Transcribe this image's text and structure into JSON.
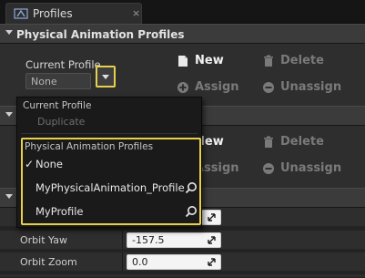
{
  "tab": {
    "label": "Profiles",
    "close": "×"
  },
  "sections": {
    "physical": {
      "title": "Physical Animation Profiles"
    }
  },
  "profile": {
    "current_label": "Current Profile",
    "current_value": "None"
  },
  "actions": {
    "new": "New",
    "delete": "Delete",
    "assign": "Assign",
    "unassign": "Unassign"
  },
  "properties": [
    {
      "name": "Orbit Yaw",
      "value": "-157.5"
    },
    {
      "name": "Orbit Zoom",
      "value": "0.0"
    }
  ],
  "popup": {
    "current_title": "Current Profile",
    "duplicate": "Duplicate",
    "list_title": "Physical Animation Profiles",
    "items": [
      {
        "label": "None",
        "checked": "✓"
      },
      {
        "label": "MyPhysicalAnimation_Profile"
      },
      {
        "label": "MyProfile"
      }
    ]
  },
  "colors": {
    "accent": "#e8d14a",
    "background": "#232323",
    "header": "#3b3b3b"
  },
  "icons": {
    "tab": "skeleton-icon",
    "new": "document-icon",
    "delete": "trash-icon",
    "assign": "plus-circle-icon",
    "unassign": "minus-circle-icon",
    "find": "search-icon"
  }
}
